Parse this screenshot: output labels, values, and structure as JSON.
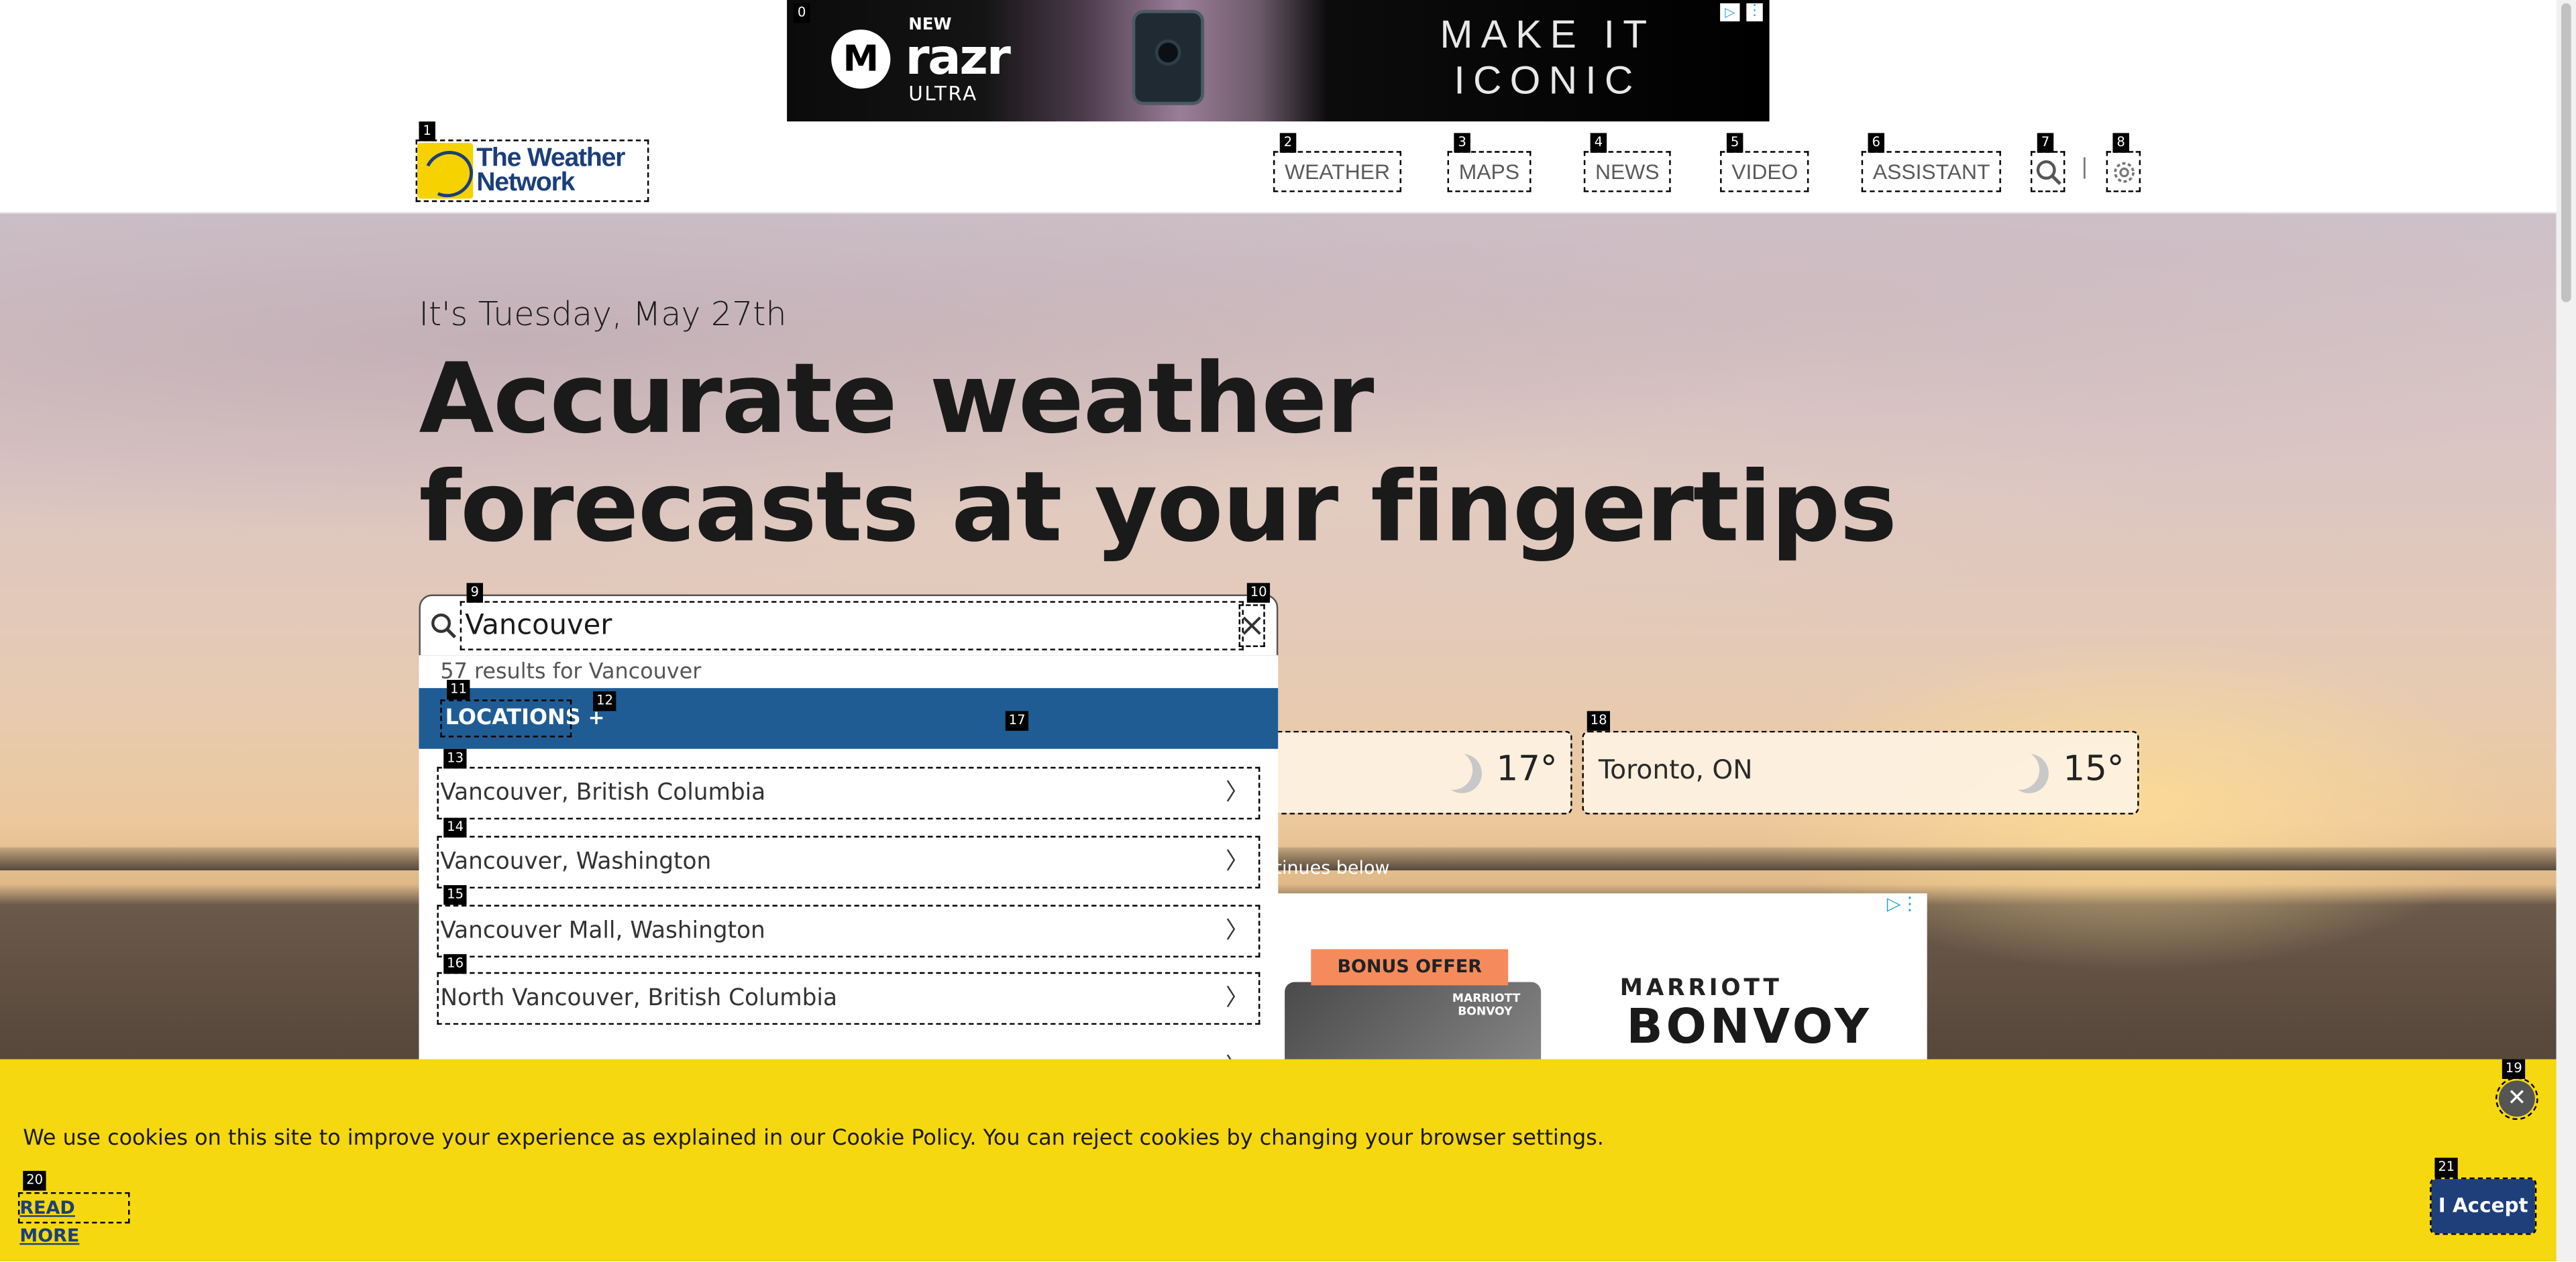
{
  "top_ad": {
    "brand_prefix": "NEW",
    "brand": "razr",
    "brand_sub": "ULTRA",
    "tagline_line1": "MAKE IT",
    "tagline_line2": "ICONIC"
  },
  "header": {
    "logo_line1": "The Weather",
    "logo_line2": "Network",
    "nav": [
      {
        "label": "WEATHER"
      },
      {
        "label": "MAPS"
      },
      {
        "label": "NEWS"
      },
      {
        "label": "VIDEO"
      },
      {
        "label": "ASSISTANT"
      }
    ],
    "separator": "|"
  },
  "hero": {
    "date_line": "It's Tuesday, May 27th",
    "headline_line1": "Accurate weather",
    "headline_line2": "forecasts at your fingertips"
  },
  "search": {
    "value": "Vancouver",
    "results_count": "57 results for Vancouver",
    "section_label": "LOCATIONS",
    "results": [
      {
        "label": "Vancouver, British Columbia"
      },
      {
        "label": "Vancouver, Washington"
      },
      {
        "label": "Vancouver Mall, Washington"
      },
      {
        "label": "North Vancouver, British Columbia"
      }
    ]
  },
  "cities": [
    {
      "name": "",
      "temp": "17°"
    },
    {
      "name": "Toronto, ON",
      "temp": "15°"
    }
  ],
  "continue_note": "tinues below",
  "mid_ad": {
    "bonus": "BONUS OFFER",
    "brand_top": "MARRIOTT",
    "brand_main": "BONVOY"
  },
  "cookie": {
    "text": "We use cookies on this site to improve your experience as explained in our Cookie Policy. You can reject cookies by changing your browser settings.",
    "read_more": "READ MORE",
    "accept": "I Accept",
    "close": "✕"
  },
  "som_labels": {
    "l0": "0",
    "l1": "1",
    "l2": "2",
    "l3": "3",
    "l4": "4",
    "l5": "5",
    "l6": "6",
    "l7": "7",
    "l8": "8",
    "l9": "9",
    "l10": "10",
    "l11": "11",
    "l12": "12",
    "l13": "13",
    "l14": "14",
    "l15": "15",
    "l16": "16",
    "l17": "17",
    "l18": "18",
    "l19": "19",
    "l20": "20",
    "l21": "21"
  }
}
